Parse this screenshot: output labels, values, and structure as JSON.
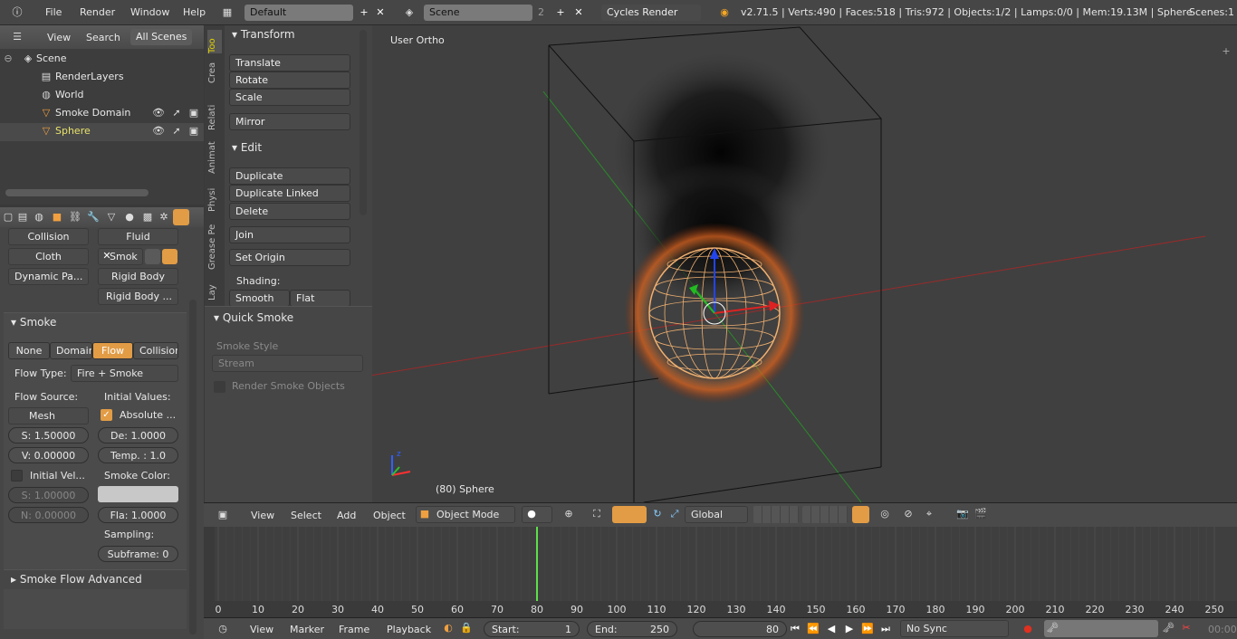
{
  "topbar": {
    "menus": [
      "File",
      "Render",
      "Window",
      "Help"
    ],
    "layout": "Default",
    "scene": "Scene",
    "scene_count": "2",
    "engine": "Cycles Render",
    "stats": "v2.71.5 | Verts:490 | Faces:518 | Tris:972 | Objects:1/2 | Lamps:0/0 | Mem:19.13M | Sphere",
    "scenes": "Scenes:1"
  },
  "outliner": {
    "menus": [
      "View",
      "Search",
      "All Scenes"
    ],
    "items": [
      "Scene",
      "RenderLayers",
      "World",
      "Smoke Domain",
      "Sphere"
    ]
  },
  "physics": {
    "buttons": [
      "Collision",
      "Fluid",
      "Cloth",
      "Smok",
      "Dynamic Pa...",
      "Rigid Body",
      "Rigid Body ..."
    ]
  },
  "smoke": {
    "title": "Smoke",
    "types": [
      "None",
      "Domain",
      "Flow",
      "Collision"
    ],
    "flow_type_label": "Flow Type:",
    "flow_type": "Fire + Smoke",
    "flow_source_label": "Flow Source:",
    "initial_values_label": "Initial Values:",
    "mesh": "Mesh",
    "absolute": "Absolute ...",
    "s": "S: 1.50000",
    "de": "De: 1.0000",
    "v": "V: 0.00000",
    "temp": "Temp. : 1.0",
    "initial_vel": "Initial Vel...",
    "smoke_color_label": "Smoke Color:",
    "s2": "S: 1.00000",
    "n": "N: 0.00000",
    "fla": "Fla: 1.0000",
    "sampling": "Sampling:",
    "subframe": "Subframe: 0",
    "advanced": "Smoke Flow Advanced"
  },
  "tools": {
    "tabs": [
      "Too",
      "Crea",
      "Relati",
      "Animat",
      "Physi",
      "Grease Pe",
      "Lay"
    ],
    "transform_title": "Transform",
    "transform": [
      "Translate",
      "Rotate",
      "Scale",
      "Mirror"
    ],
    "edit_title": "Edit",
    "edit": [
      "Duplicate",
      "Duplicate Linked",
      "Delete",
      "Join",
      "Set Origin"
    ],
    "shading": "Shading:",
    "smooth": "Smooth",
    "flat": "Flat",
    "quick_smoke": "Quick Smoke",
    "smoke_style_label": "Smoke Style",
    "smoke_style": "Stream",
    "render_smoke": "Render Smoke Objects"
  },
  "viewport": {
    "view_name": "User Ortho",
    "object_info": "(80) Sphere"
  },
  "vphdr": {
    "menus": [
      "View",
      "Select",
      "Add",
      "Object"
    ],
    "mode": "Object Mode",
    "orientation": "Global"
  },
  "timeline": {
    "ticks": [
      "0",
      "10",
      "20",
      "30",
      "40",
      "50",
      "60",
      "70",
      "80",
      "90",
      "100",
      "110",
      "120",
      "130",
      "140",
      "150",
      "160",
      "170",
      "180",
      "190",
      "200",
      "210",
      "220",
      "230",
      "240",
      "250"
    ],
    "current_frame": 80,
    "menus": [
      "View",
      "Marker",
      "Frame",
      "Playback"
    ],
    "start": "Start:",
    "start_val": "1",
    "end": "End:",
    "end_val": "250",
    "frame_val": "80",
    "sync": "No Sync",
    "time": "00:00"
  }
}
